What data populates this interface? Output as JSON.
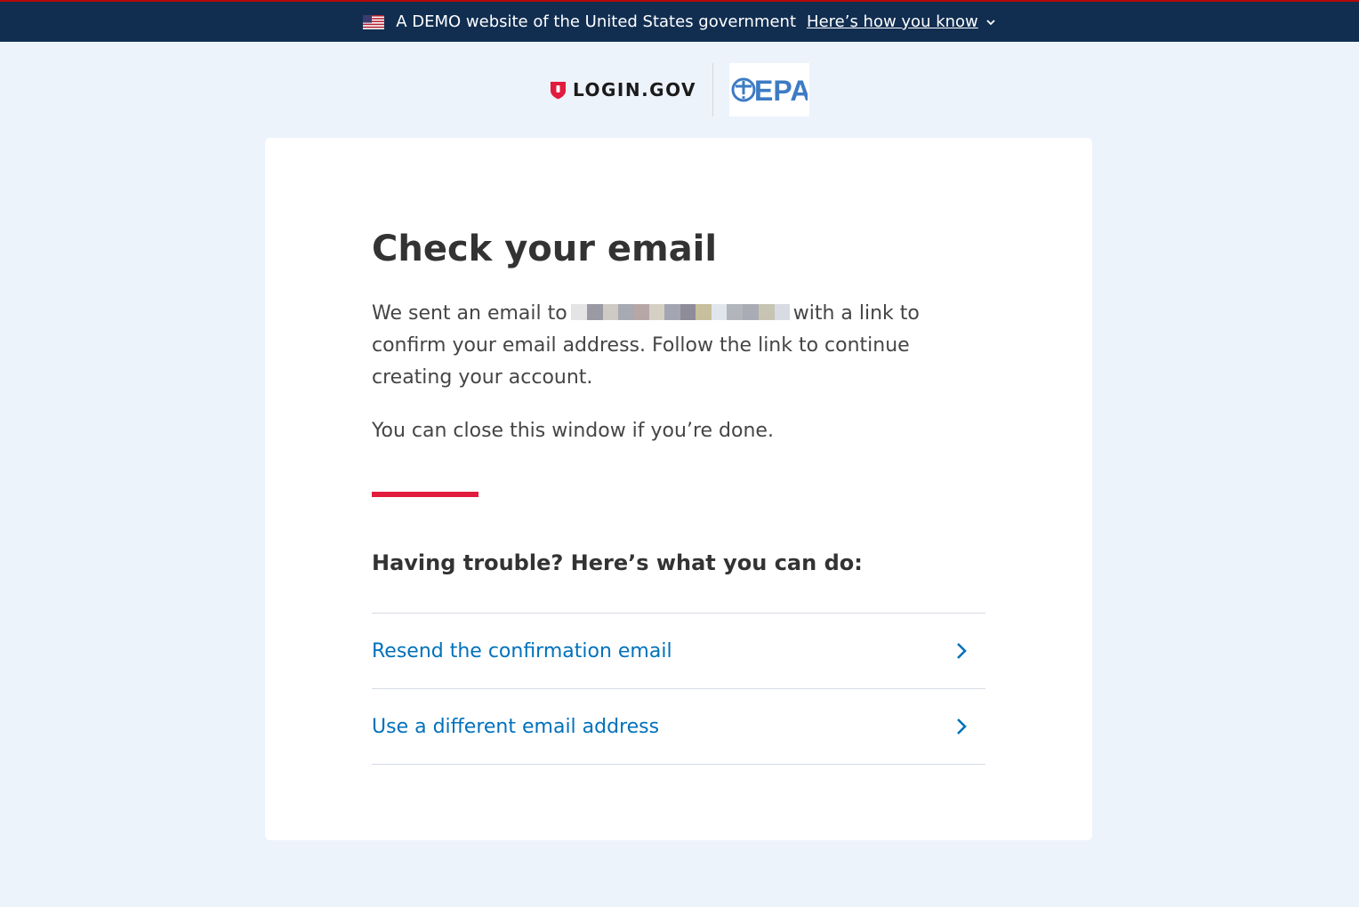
{
  "banner": {
    "text": "A DEMO website of the United States government",
    "link_label": "Here’s how you know",
    "flag_icon": "us-flag-icon",
    "colors": {
      "background": "#112e51",
      "top_border": "#b50909"
    }
  },
  "header": {
    "login_logo_text": "LOGIN.GOV",
    "partner_logo_text": "EPA"
  },
  "card": {
    "title": "Check your email",
    "message_before": "We sent an email to",
    "message_after": "with a link to confirm your email address. Follow the link to continue creating your account.",
    "close_note": "You can close this window if you’re done.",
    "trouble_heading": "Having trouble? Here’s what you can do:",
    "options": [
      {
        "label": "Resend the confirmation email",
        "icon": "chevron-right-icon"
      },
      {
        "label": "Use a different email address",
        "icon": "chevron-right-icon"
      }
    ]
  },
  "colors": {
    "page_background": "#edf3fb",
    "link": "#0071bb",
    "accent_rule": "#e21c3d"
  }
}
